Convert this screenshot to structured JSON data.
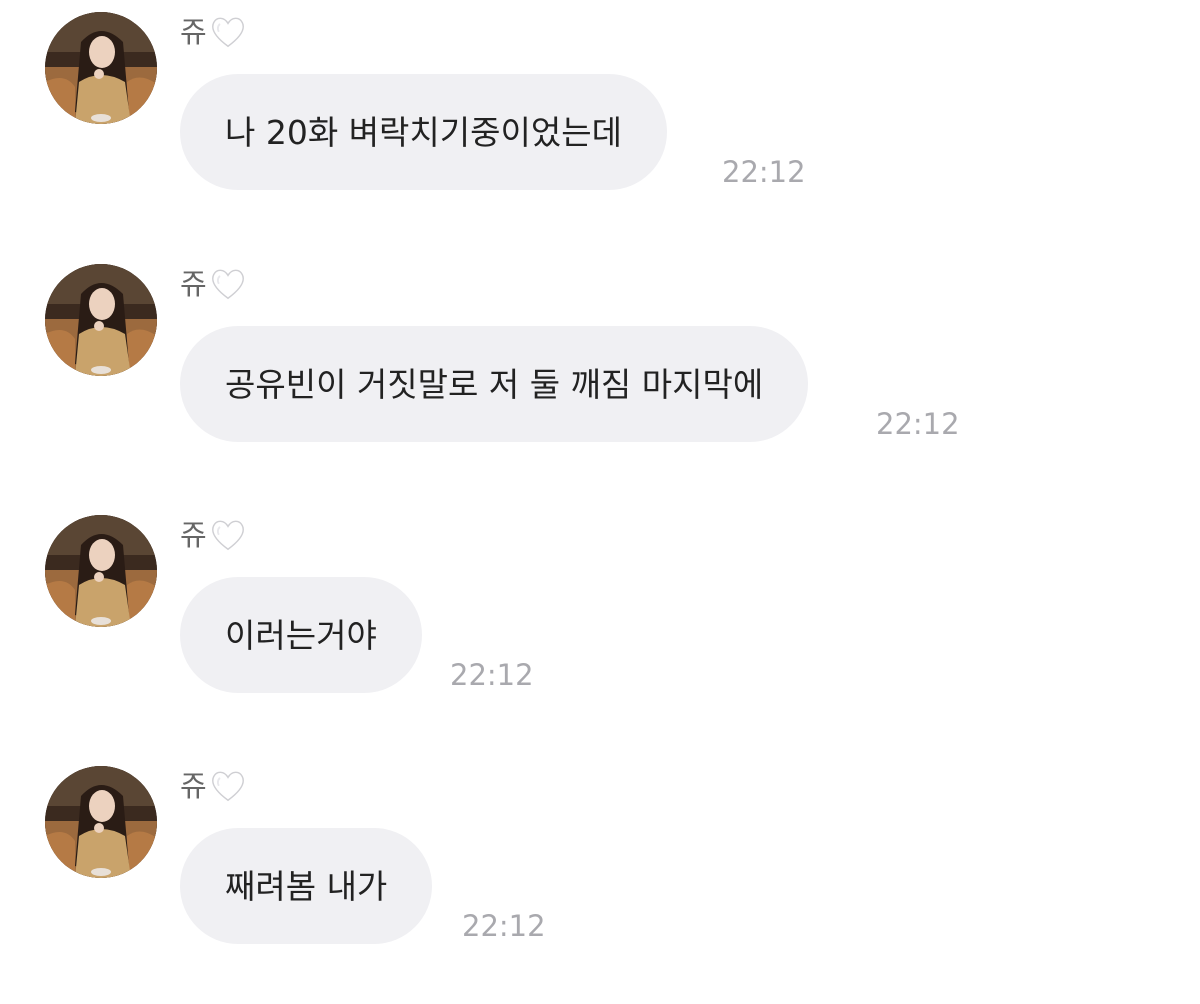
{
  "messages": [
    {
      "sender": "쥬",
      "text": "나 20화 벼락치기중이었는데",
      "time": "22:12"
    },
    {
      "sender": "쥬",
      "text": "공유빈이 거짓말로 저 둘 깨짐 마지막에",
      "time": "22:12"
    },
    {
      "sender": "쥬",
      "text": "이러는거야",
      "time": "22:12"
    },
    {
      "sender": "쥬",
      "text": "째려봄 내가",
      "time": "22:12"
    }
  ],
  "icons": {
    "sender_badge": "white-heart-icon",
    "avatar": "profile-photo"
  },
  "colors": {
    "bubble": "#f0f0f3",
    "timestamp": "#a9a9ae",
    "sender_name": "#666666",
    "message_text": "#222222"
  }
}
